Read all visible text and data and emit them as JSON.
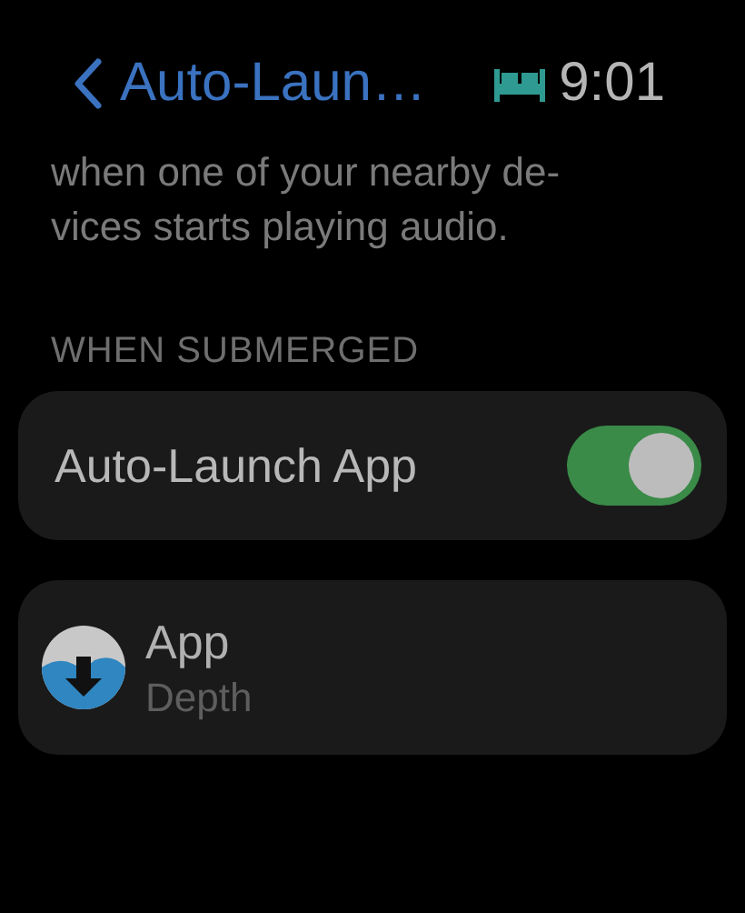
{
  "header": {
    "back_label": "Auto-Laun…",
    "time": "9:01"
  },
  "description": [
    "when one of your nearby de-",
    "vices starts playing audio."
  ],
  "section": {
    "title": "WHEN SUBMERGED"
  },
  "toggle_row": {
    "label": "Auto-Launch App",
    "on": true
  },
  "app_row": {
    "title": "App",
    "subtitle": "Depth"
  }
}
